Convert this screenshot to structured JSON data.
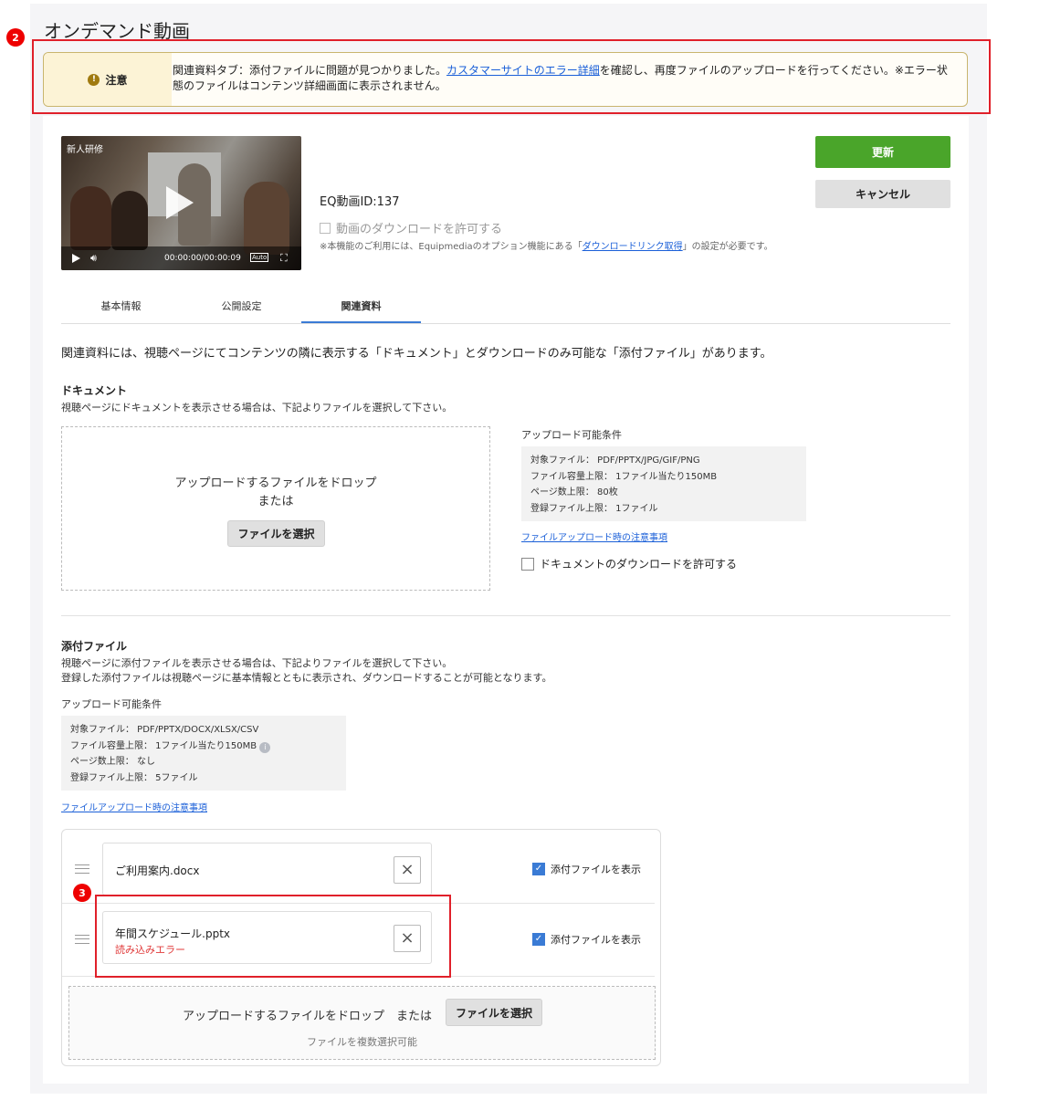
{
  "page": {
    "title": "オンデマンド動画",
    "markers": {
      "notice": "2",
      "file_error": "3"
    }
  },
  "notice": {
    "label": "注意",
    "text_before": "関連資料タブ：添付ファイルに問題が見つかりました。",
    "link": "カスタマーサイトのエラー詳細",
    "text_after": "を確認し、再度ファイルのアップロードを行ってください。※エラー状態のファイルはコンテンツ詳細画面に表示されません。"
  },
  "video": {
    "tag": "新人研修",
    "time": "00:00:00/00:00:09",
    "quality": "Auto",
    "eq_id": "EQ動画ID:137",
    "download_label": "動画のダウンロードを許可する",
    "download_checked": false,
    "note_before": "※本機能のご利用には、Equipmediaのオプション機能にある「",
    "note_link": "ダウンロードリンク取得",
    "note_after": "」の設定が必要です。"
  },
  "actions": {
    "update": "更新",
    "cancel": "キャンセル"
  },
  "tabs": [
    {
      "label": "基本情報",
      "active": false
    },
    {
      "label": "公開設定",
      "active": false
    },
    {
      "label": "関連資料",
      "active": true
    }
  ],
  "intro": "関連資料には、視聴ページにてコンテンツの隣に表示する「ドキュメント」とダウンロードのみ可能な「添付ファイル」があります。",
  "document": {
    "title": "ドキュメント",
    "desc": "視聴ページにドキュメントを表示させる場合は、下記よりファイルを選択して下さい。",
    "drop_text": "アップロードするファイルをドロップ",
    "or": "または",
    "select_button": "ファイルを選択",
    "conditions_title": "アップロード可能条件",
    "conditions": [
      "対象ファイル： PDF/PPTX/JPG/GIF/PNG",
      "ファイル容量上限： 1ファイル当たり150MB",
      "ページ数上限： 80枚",
      "登録ファイル上限： 1ファイル"
    ],
    "notes_link": "ファイルアップロード時の注意事項",
    "allow_download": "ドキュメントのダウンロードを許可する",
    "allow_download_checked": false
  },
  "attachments": {
    "title": "添付ファイル",
    "desc1": "視聴ページに添付ファイルを表示させる場合は、下記よりファイルを選択して下さい。",
    "desc2": "登録した添付ファイルは視聴ページに基本情報とともに表示され、ダウンロードすることが可能となります。",
    "conditions_title": "アップロード可能条件",
    "conditions": [
      "対象ファイル： PDF/PPTX/DOCX/XLSX/CSV",
      "ファイル容量上限： 1ファイル当たり150MB",
      "ページ数上限： なし",
      "登録ファイル上限： 5ファイル"
    ],
    "notes_link": "ファイルアップロード時の注意事項",
    "files": [
      {
        "name": "ご利用案内.docx",
        "error": "",
        "show_label": "添付ファイルを表示",
        "show_checked": true
      },
      {
        "name": "年間スケジュール.pptx",
        "error": "読み込みエラー",
        "show_label": "添付ファイルを表示",
        "show_checked": true
      }
    ],
    "drop_text": "アップロードするファイルをドロップ　または",
    "select_button": "ファイルを選択",
    "multi_note": "ファイルを複数選択可能"
  },
  "colors": {
    "accent": "#3a7bd5",
    "update_button": "#4aa52a",
    "error": "#e03a3a",
    "marker": "#e00000",
    "notice_border": "#c9b56e"
  },
  "icons": {
    "notice": "warning-info-icon",
    "close": "close-icon",
    "drag": "drag-handle-icon",
    "info": "info-icon",
    "play": "play-icon",
    "volume": "volume-icon",
    "fullscreen": "fullscreen-icon"
  }
}
